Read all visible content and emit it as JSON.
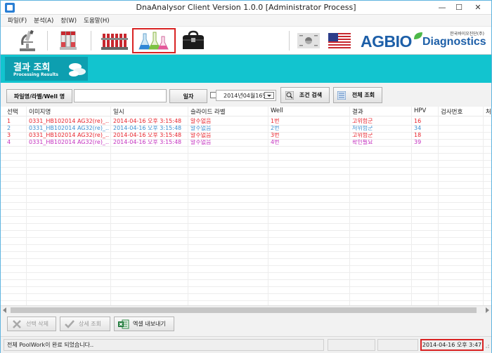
{
  "window": {
    "title": "DnaAnalysor Client Version 1.0.0 [Administrator Process]",
    "minimize": "—",
    "maximize": "☐",
    "close": "✕"
  },
  "menu": [
    {
      "label": "파일(F)"
    },
    {
      "label": "분석(A)"
    },
    {
      "label": "창(W)"
    },
    {
      "label": "도움말(H)"
    }
  ],
  "toolbar": {
    "tools": [
      {
        "name": "microscope-tool",
        "icon": "microscope-icon"
      },
      {
        "name": "sample-tubes-tool",
        "icon": "test-tubes-icon"
      },
      {
        "name": "reagent-rack-tool",
        "icon": "tube-rack-icon"
      },
      {
        "name": "flasks-tool",
        "icon": "flasks-icon",
        "selected": true
      },
      {
        "name": "bag-tool",
        "icon": "doctor-bag-icon"
      }
    ],
    "flags": [
      {
        "name": "korea-flag",
        "icon": "korea-flag-icon"
      },
      {
        "name": "usa-flag",
        "icon": "usa-flag-icon"
      }
    ],
    "logo": {
      "main": "AGBIO",
      "sub": "Diagnostics",
      "korean": "한국바이오진단(주)",
      "accent_color": "#4db848",
      "brand_color": "#1d5fa8"
    }
  },
  "banner": {
    "title": "결과 조회",
    "subtitle": "Processing Results",
    "color": "#12c4cf"
  },
  "search": {
    "name_button": "파일명/라벨/Well 명",
    "name_value": "",
    "date_button": "일자",
    "date_value": "2014년04월16일",
    "condition_search": "조건 검색",
    "all_search": "전체 조회"
  },
  "grid": {
    "columns": [
      "선택",
      "이미지명",
      "일시",
      "슬라이드 라벨",
      "Well",
      "결과",
      "HPV",
      "검사번호",
      "처"
    ],
    "rows": [
      {
        "sel": "1",
        "image": "0331_HB102014 AG32(re)_...",
        "datetime": "2014-04-16 오후 3:15:48",
        "label": "알수없음",
        "well": "1번",
        "result": "고위험군",
        "hpv": "16",
        "color": "#e8232b"
      },
      {
        "sel": "2",
        "image": "0331_HB102014 AG32(re)_...",
        "datetime": "2014-04-16 오후 3:15:48",
        "label": "알수없음",
        "well": "2번",
        "result": "저위험군",
        "hpv": "34",
        "color": "#3a8fd0"
      },
      {
        "sel": "3",
        "image": "0331_HB102014 AG32(re)_...",
        "datetime": "2014-04-16 오후 3:15:48",
        "label": "알수없음",
        "well": "3번",
        "result": "고위험군",
        "hpv": "18",
        "color": "#e8232b"
      },
      {
        "sel": "4",
        "image": "0331_HB102014 AG32(re)_...",
        "datetime": "2014-04-16 오후 3:15:48",
        "label": "알수없음",
        "well": "4번",
        "result": "확인필요",
        "hpv": "39",
        "color": "#c32fbf"
      }
    ]
  },
  "bottom": {
    "delete_selected": "선택 삭제",
    "detail_view": "상세 조회",
    "excel_export": "엑셀 내보내기"
  },
  "status": {
    "message": "전체 PoolWork이 완료 되었습니다..",
    "datetime": "2014-04-16 오후 3:47"
  }
}
